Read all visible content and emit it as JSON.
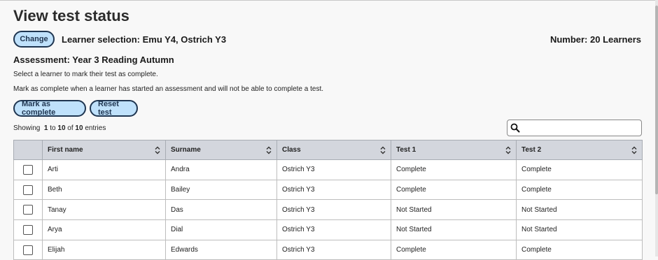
{
  "page": {
    "title": "View test status"
  },
  "learner": {
    "change_label": "Change",
    "selection": "Learner selection: Emu Y4, Ostrich Y3",
    "number": "Number: 20 Learners"
  },
  "assessment": {
    "title": "Assessment: Year 3 Reading Autumn"
  },
  "instructions": {
    "line1": "Select a learner to mark their test as complete.",
    "line2": "Mark as complete when a learner has started an assessment and will not be able to complete a test."
  },
  "actions": {
    "mark_complete_label": "Mark as complete",
    "reset_label": "Reset test"
  },
  "entries": {
    "prefix": "Showing",
    "from": "1",
    "to_word": "to",
    "to": "10",
    "of_word": "of",
    "total": "10",
    "suffix": "entries"
  },
  "search": {
    "value": "",
    "placeholder": ""
  },
  "table": {
    "columns": [
      "First name",
      "Surname",
      "Class",
      "Test 1",
      "Test 2"
    ],
    "rows": [
      [
        "Arti",
        "Andra",
        "Ostrich Y3",
        "Complete",
        "Complete"
      ],
      [
        "Beth",
        "Bailey",
        "Ostrich Y3",
        "Complete",
        "Complete"
      ],
      [
        "Tanay",
        "Das",
        "Ostrich Y3",
        "Not Started",
        "Not Started"
      ],
      [
        "Arya",
        "Dial",
        "Ostrich Y3",
        "Not Started",
        "Not Started"
      ],
      [
        "Elijah",
        "Edwards",
        "Ostrich Y3",
        "Complete",
        "Complete"
      ]
    ]
  },
  "colors": {
    "button_bg": "#bfe1fb",
    "button_border": "#1f3550",
    "header_bg": "#d3d6dd"
  }
}
